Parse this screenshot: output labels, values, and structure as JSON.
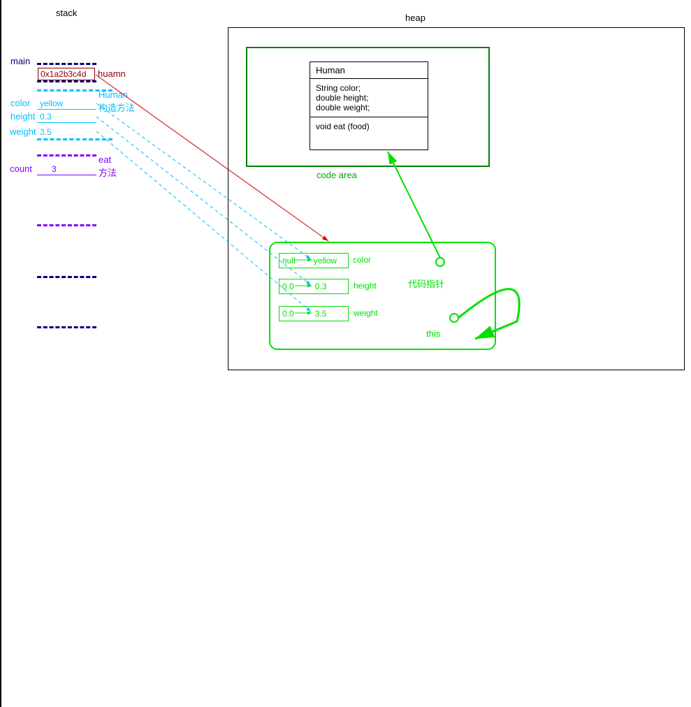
{
  "titles": {
    "stack": "stack",
    "heap": "heap",
    "code_area": "code area"
  },
  "stack": {
    "main_label": "main",
    "address": "0x1a2b3c4d",
    "human_label": "huamn",
    "human_constructor": "Human",
    "constructor_note": "构造方法",
    "color_label": "color",
    "color_value": "yellow",
    "height_label": "height",
    "height_value": "0.3",
    "weight_label": "weight",
    "weight_value": "3.5",
    "eat_label": "eat",
    "method_note": "方法",
    "count_label": "count",
    "count_value": "3"
  },
  "human_class": {
    "name": "Human",
    "field1": "String color;",
    "field2": "double height;",
    "field3": "double weight;",
    "method": "void eat (food)"
  },
  "object": {
    "color_old": "null",
    "color_new": "yellow",
    "color_label": "color",
    "height_old": "0.0",
    "height_new": "0.3",
    "height_label": "height",
    "weight_old": "0.0",
    "weight_new": "3.5",
    "weight_label": "weight",
    "code_ptr": "代码指针",
    "this_label": "this"
  }
}
